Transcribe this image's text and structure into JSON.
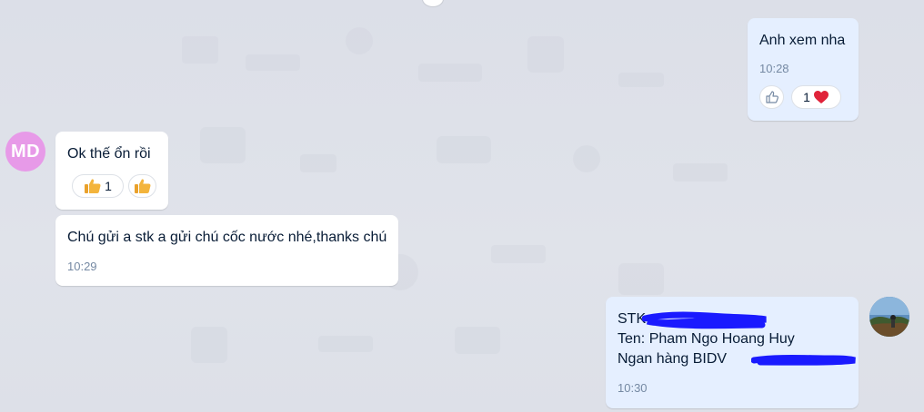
{
  "avatars": {
    "contact_initials": "MD"
  },
  "messages": [
    {
      "id": "m1",
      "text": "Anh xem nha",
      "time": "10:28",
      "reactions": [
        {
          "icon": "like-outline-icon"
        },
        {
          "count": "1",
          "icon": "heart-icon"
        }
      ]
    },
    {
      "id": "m2",
      "text": "Ok thế ổn rồi",
      "reactions": [
        {
          "count": "1",
          "icon": "thumbs-up-icon"
        },
        {
          "icon": "thumbs-up-icon"
        }
      ]
    },
    {
      "id": "m3",
      "text": "Chú gửi a stk a gửi chú cốc nước nhé,thanks chú",
      "time": "10:29"
    },
    {
      "id": "m4",
      "lines": [
        "STK:",
        "Ten: Pham Ngo Hoang Huy",
        "Ngan hàng BIDV"
      ],
      "time": "10:30"
    }
  ],
  "colors": {
    "background": "#dfe2ea",
    "incoming_bubble": "#ffffff",
    "outgoing_bubble": "#e5efff",
    "avatar_md": "#e79ae8",
    "redaction": "#1a1aff",
    "heart": "#e0233a",
    "thumb": "#f3b43c"
  }
}
